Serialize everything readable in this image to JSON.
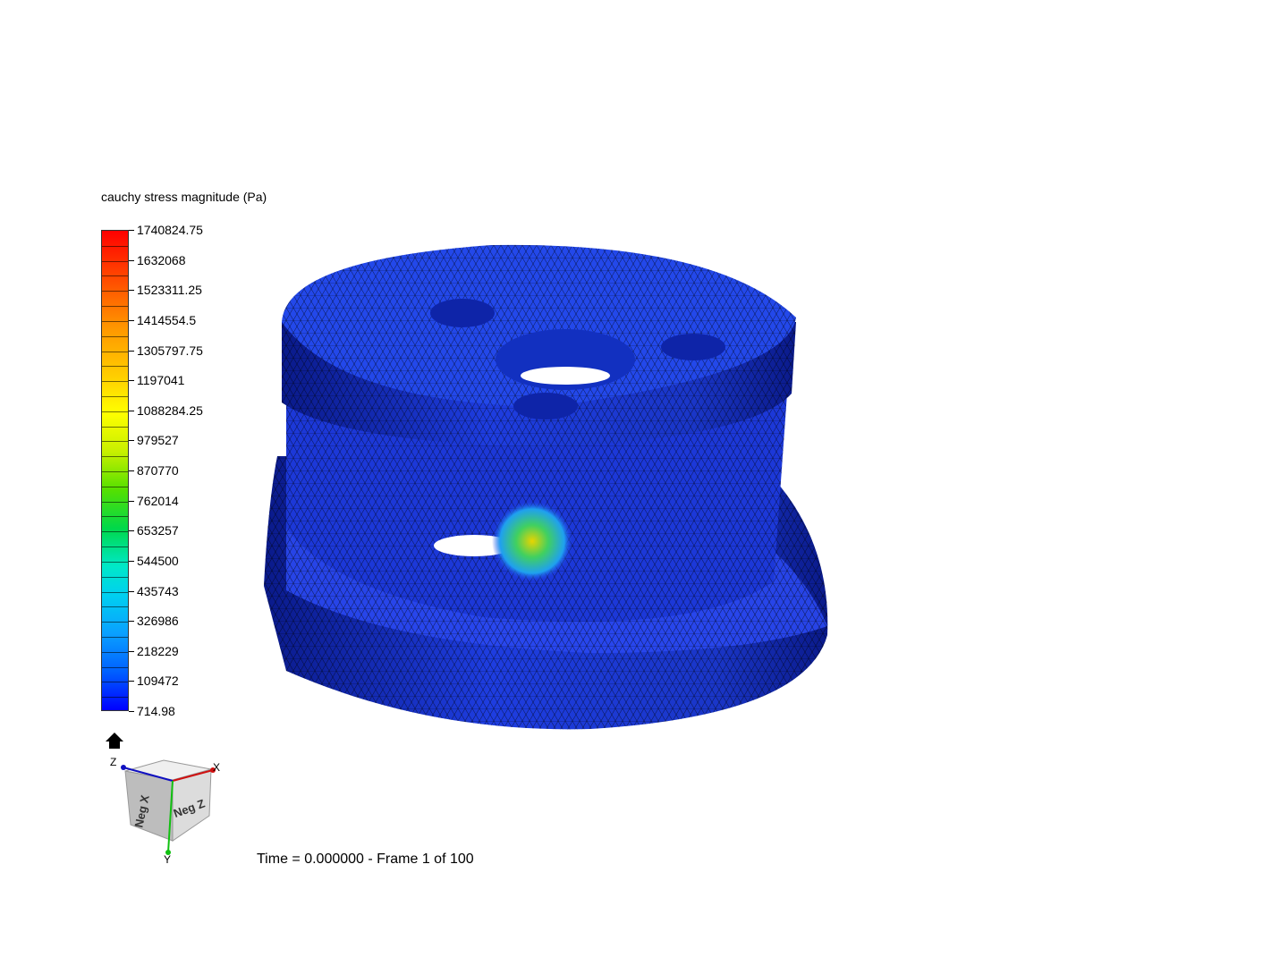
{
  "legend": {
    "title": "cauchy stress magnitude (Pa)",
    "ticks": [
      "1740824.75",
      "1632068",
      "1523311.25",
      "1414554.5",
      "1305797.75",
      "1197041",
      "1088284.25",
      "979527",
      "870770",
      "762014",
      "653257",
      "544500",
      "435743",
      "326986",
      "218229",
      "109472",
      "714.98"
    ],
    "min_color": "#0000ff",
    "max_color": "#ff0000"
  },
  "orientation": {
    "axis_x": "X",
    "axis_y": "Y",
    "axis_z": "Z",
    "face_left": "Neg X",
    "face_right": "Neg Z",
    "axis_x_color": "#d01010",
    "axis_y_color": "#10c010",
    "axis_z_color": "#1010c0",
    "home_icon": "home-icon"
  },
  "status": {
    "text": "Time = 0.000000 - Frame 1 of 100"
  },
  "model": {
    "base_color": "#1f3fe6",
    "hotspot_color": "#e8d400"
  }
}
